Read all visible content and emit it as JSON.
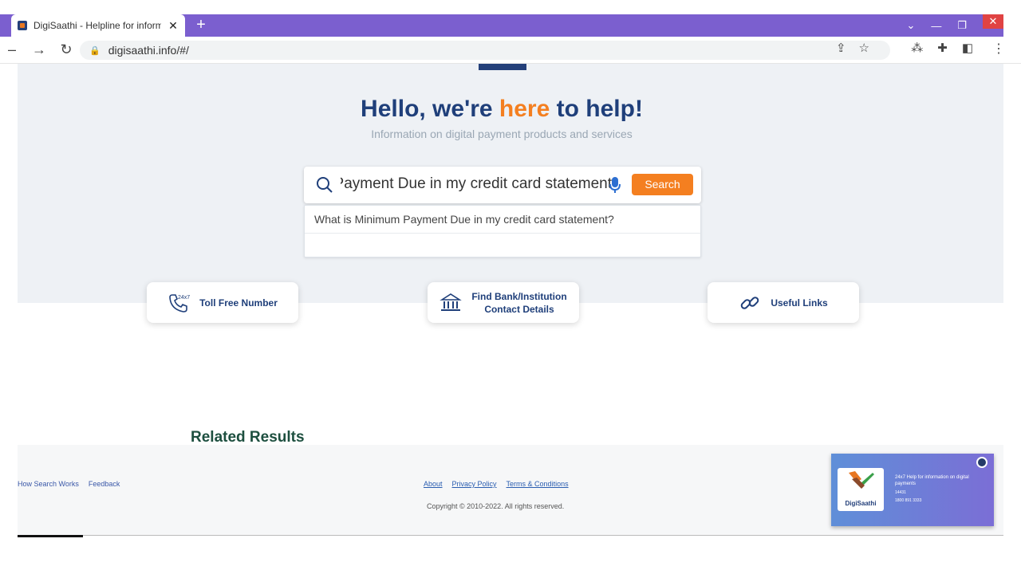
{
  "browser": {
    "tab_title": "DigiSaathi - Helpline for information",
    "tab_close": "✕",
    "new_tab": "+",
    "url": "digisaathi.info/#/",
    "window_controls": {
      "dropdown": "⌄",
      "minimize": "—",
      "restore": "❐",
      "close": "✕"
    }
  },
  "hero": {
    "title_part1": "Hello, we're ",
    "title_accent": "here",
    "title_part2": " to help!",
    "subtitle": "Information on digital payment products and services",
    "accent_color": "#f47f20",
    "title_color": "#1f3f7a"
  },
  "search": {
    "value": "What is Minimum Payment Due in my credit card statement?",
    "button_label": "Search",
    "suggestions": [
      "What is Minimum Payment Due in my credit card statement?"
    ]
  },
  "cards": [
    {
      "label": "Toll Free Number",
      "icon": "phone-24x7-icon"
    },
    {
      "label_line1": "Find Bank/Institution",
      "label_line2": "Contact Details",
      "icon": "bank-icon"
    },
    {
      "label": "Useful Links",
      "icon": "link-icon"
    }
  ],
  "related": {
    "heading": "Related Results"
  },
  "footer": {
    "left_links": [
      "How Search Works",
      "Feedback"
    ],
    "links": [
      "About",
      "Privacy Policy",
      "Terms & Conditions"
    ],
    "copyright": "Copyright © 2010-2022. All rights reserved.",
    "promo": {
      "logo_text": "DigiSaathi",
      "headline": "24x7 Help for information on digital payments",
      "phone_short": "14431",
      "phone_long": "1800 891 3333"
    }
  }
}
